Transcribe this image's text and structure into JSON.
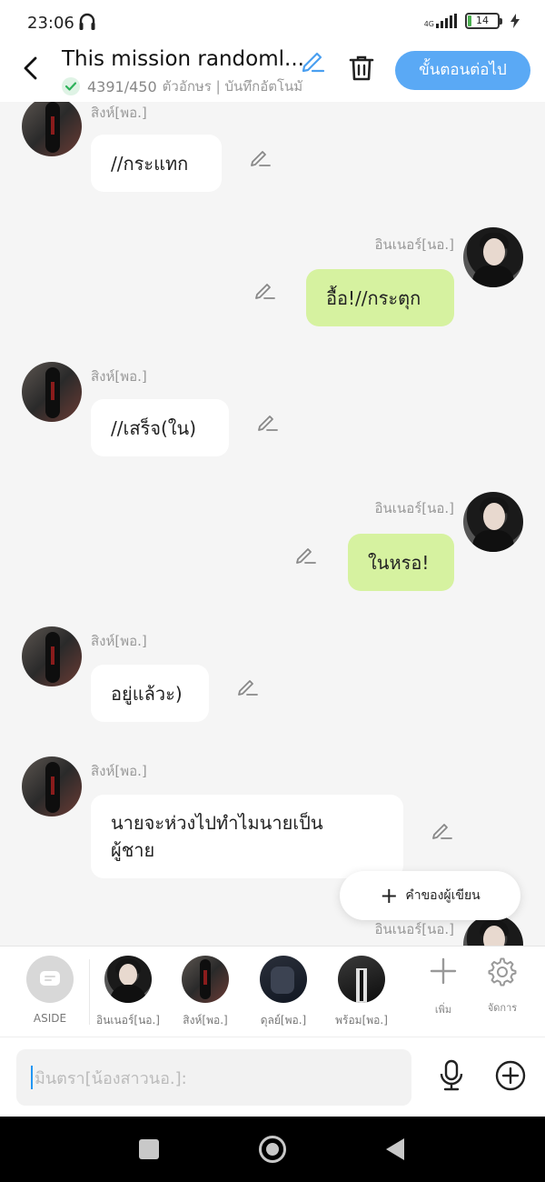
{
  "status": {
    "time": "23:06",
    "network": "4G",
    "battery": "14"
  },
  "header": {
    "title": "This mission randoml...",
    "count": "4391/450",
    "subtitle": "ตัวอักษร | บันทึกอัตโนมั",
    "next_label": "ขั้นตอนต่อไป"
  },
  "messages": [
    {
      "side": "left",
      "sender": "สิงห์[พอ.]",
      "text": "//กระแทก"
    },
    {
      "side": "right",
      "sender": "อินเนอร์[นอ.]",
      "text": "อื้อ!//กระตุก"
    },
    {
      "side": "left",
      "sender": "สิงห์[พอ.]",
      "text": "//เสร็จ(ใน)"
    },
    {
      "side": "right",
      "sender": "อินเนอร์[นอ.]",
      "text": "ในหรอ!"
    },
    {
      "side": "left",
      "sender": "สิงห์[พอ.]",
      "text": "อยู่แล้วะ)"
    },
    {
      "side": "left",
      "sender": "สิงห์[พอ.]",
      "text_lines": [
        "นายจะห่วงไปทำไมนายเป็น",
        "ผู้ชาย"
      ]
    },
    {
      "side": "right",
      "sender": "อินเนอร์[นอ.]"
    }
  ],
  "narration_label": "คำของผู้เขียน",
  "characters": {
    "aside": "ASIDE",
    "items": [
      {
        "name": "อินเนอร์[นอ.]"
      },
      {
        "name": "สิงห์[พอ.]"
      },
      {
        "name": "ดุลย์[พอ.]"
      },
      {
        "name": "พร้อม[พอ.]"
      }
    ],
    "add_label": "เพิ่ม",
    "manage_label": "จัดการ"
  },
  "input": {
    "placeholder": "มินตรา[น้องสาวนอ.]:"
  },
  "icons": [
    "headset-icon",
    "signal-icon",
    "battery-icon",
    "charging-icon",
    "back-icon",
    "edit-icon",
    "check-icon",
    "trash-icon",
    "pencil-icon",
    "plus-icon",
    "gear-icon",
    "chat-bubble-icon",
    "mic-icon",
    "add-circle-icon"
  ],
  "colors": {
    "accent": "#5aa9f5",
    "right_bubble": "#d6f2a0",
    "left_bubble": "#ffffff"
  }
}
